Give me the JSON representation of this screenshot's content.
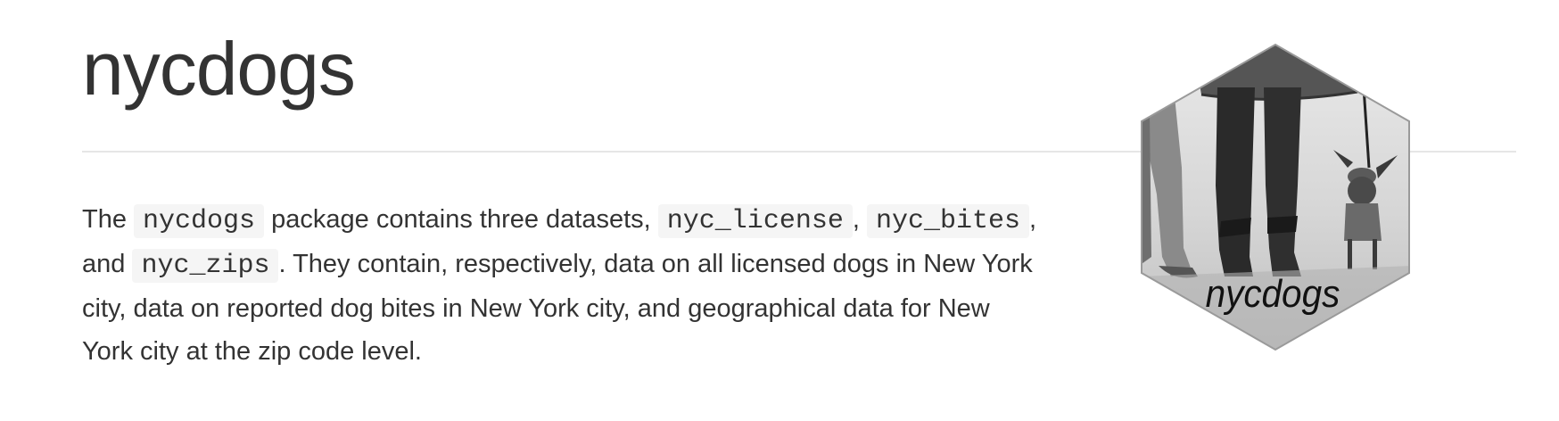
{
  "header": {
    "title": "nycdogs"
  },
  "intro": {
    "t1": "The ",
    "code_package": "nycdogs",
    "t2": " package contains three datasets, ",
    "code_license": "nyc_license",
    "t3": ",",
    "code_bites": "nyc_bites",
    "t4": ", and ",
    "code_zips": "nyc_zips",
    "t5": ". They contain, respectively, data on all licensed dogs in New York city, data on reported dog bites in New York city, and geographical data for New York city at the zip code level."
  },
  "logo": {
    "text": "nycdogs",
    "icon": "hex-sticker-photo-logo"
  },
  "colors": {
    "text": "#333333",
    "rule": "#e6e6e6",
    "code_bg": "#f5f5f5"
  }
}
